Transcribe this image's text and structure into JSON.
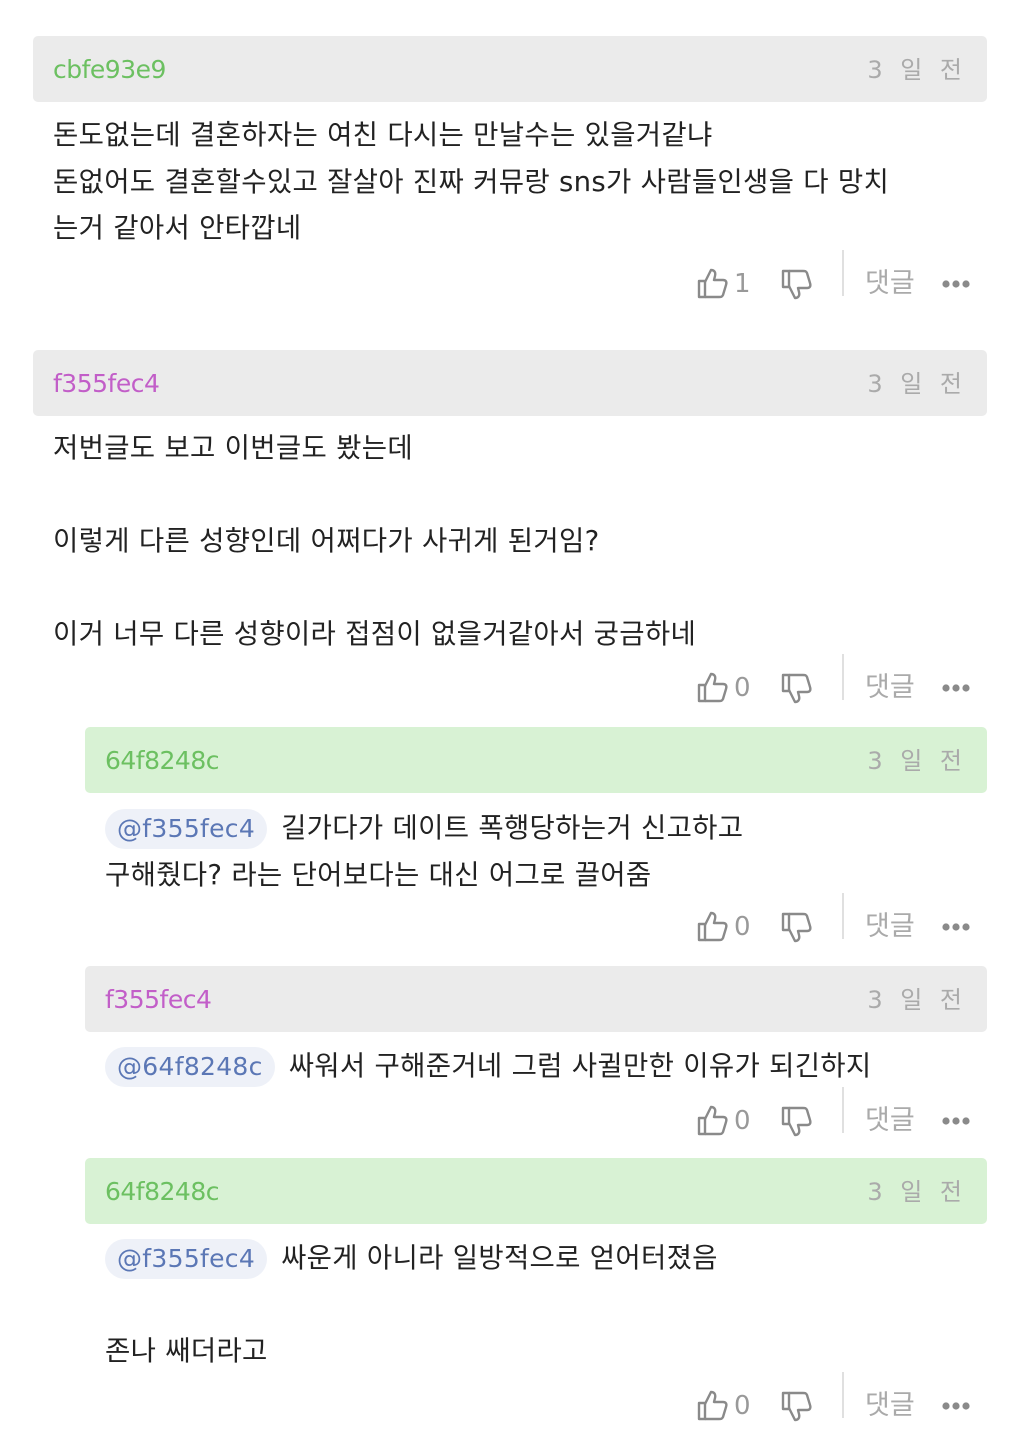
{
  "colors": {
    "header_gray": "#ebebeb",
    "header_green": "#d8f2d4",
    "author_green": "#6cc061",
    "author_purple": "#c25ec8",
    "mention_bg": "#eef1f8",
    "mention_text": "#5b77b5",
    "muted": "#aaaaaa"
  },
  "icons": {
    "like": "thumbs-up-icon",
    "dislike": "thumbs-down-icon",
    "more": "more-dots-icon"
  },
  "comments": [
    {
      "author": "cbfe93e9",
      "time": "3 일 전",
      "lines": [
        "돈도없는데 결혼하자는 여친 다시는 만날수는 있을거같냐",
        "돈없어도 결혼할수있고 잘살아 진짜 커뮤랑 sns가 사람들인생을 다 망치",
        "는거 같아서 안타깝네"
      ],
      "likes": "1",
      "reply_label": "댓글"
    },
    {
      "author": "f355fec4",
      "time": "3 일 전",
      "lines": [
        "저번글도 보고 이번글도 봤는데",
        "",
        "이렇게 다른 성향인데 어쩌다가 사귀게 된거임?",
        "",
        "이거 너무 다른 성향이라 접점이 없을거같아서 궁금하네"
      ],
      "likes": "0",
      "reply_label": "댓글"
    },
    {
      "author": "64f8248c",
      "time": "3 일 전",
      "mention": "@f355fec4",
      "lines": [
        "길가다가 데이트 폭행당하는거 신고하고",
        "구해줬다? 라는 단어보다는 대신 어그로 끌어줌"
      ],
      "likes": "0",
      "reply_label": "댓글"
    },
    {
      "author": "f355fec4",
      "time": "3 일 전",
      "mention": "@64f8248c",
      "lines": [
        "싸워서 구해준거네 그럼 사귈만한 이유가 되긴하지"
      ],
      "likes": "0",
      "reply_label": "댓글"
    },
    {
      "author": "64f8248c",
      "time": "3 일 전",
      "mention": "@f355fec4",
      "lines": [
        "싸운게 아니라 일방적으로 얻어터졌음",
        "",
        "존나 쌔더라고"
      ],
      "likes": "0",
      "reply_label": "댓글"
    }
  ]
}
